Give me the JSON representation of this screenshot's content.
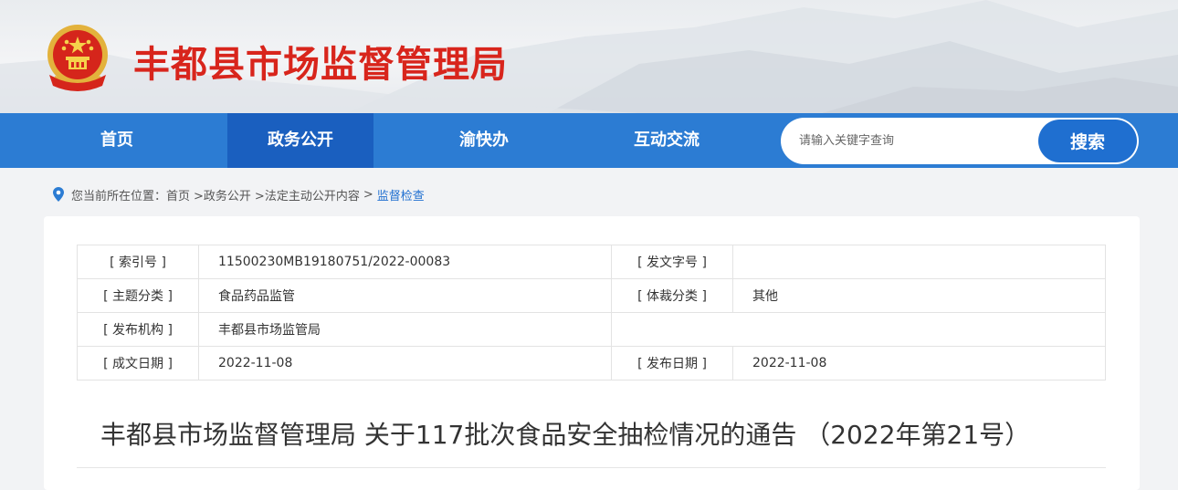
{
  "header": {
    "site_title": "丰都县市场监督管理局",
    "emblem_icon": "national-emblem-icon"
  },
  "nav": {
    "items": [
      {
        "label": "首页",
        "active": false
      },
      {
        "label": "政务公开",
        "active": true
      },
      {
        "label": "渝快办",
        "active": false
      },
      {
        "label": "互动交流",
        "active": false
      }
    ]
  },
  "search": {
    "placeholder": "请输入关键字查询",
    "button_label": "搜索"
  },
  "breadcrumb": {
    "icon": "location-pin-icon",
    "items": [
      "您当前所在位置：首页",
      ">政务公开",
      ">法定主动公开内容",
      ">",
      "监督检查"
    ]
  },
  "meta": {
    "index_no_label": "[ 索引号 ]",
    "index_no": "11500230MB19180751/2022-00083",
    "doc_no_label": "[ 发文字号 ]",
    "doc_no": "",
    "topic_label": "[ 主题分类 ]",
    "topic": "食品药品监管",
    "genre_label": "[ 体裁分类 ]",
    "genre": "其他",
    "publisher_label": "[ 发布机构 ]",
    "publisher": "丰都县市场监管局",
    "created_label": "[ 成文日期 ]",
    "created_date": "2022-11-08",
    "published_label": "[ 发布日期 ]",
    "published_date": "2022-11-08"
  },
  "document": {
    "title": "丰都县市场监督管理局 关于117批次食品安全抽检情况的通告 （2022年第21号）"
  },
  "colors": {
    "nav_blue": "#2c7cd3",
    "nav_active": "#1a5fbf",
    "title_red": "#d8251c",
    "link_blue": "#1f6fd0"
  }
}
